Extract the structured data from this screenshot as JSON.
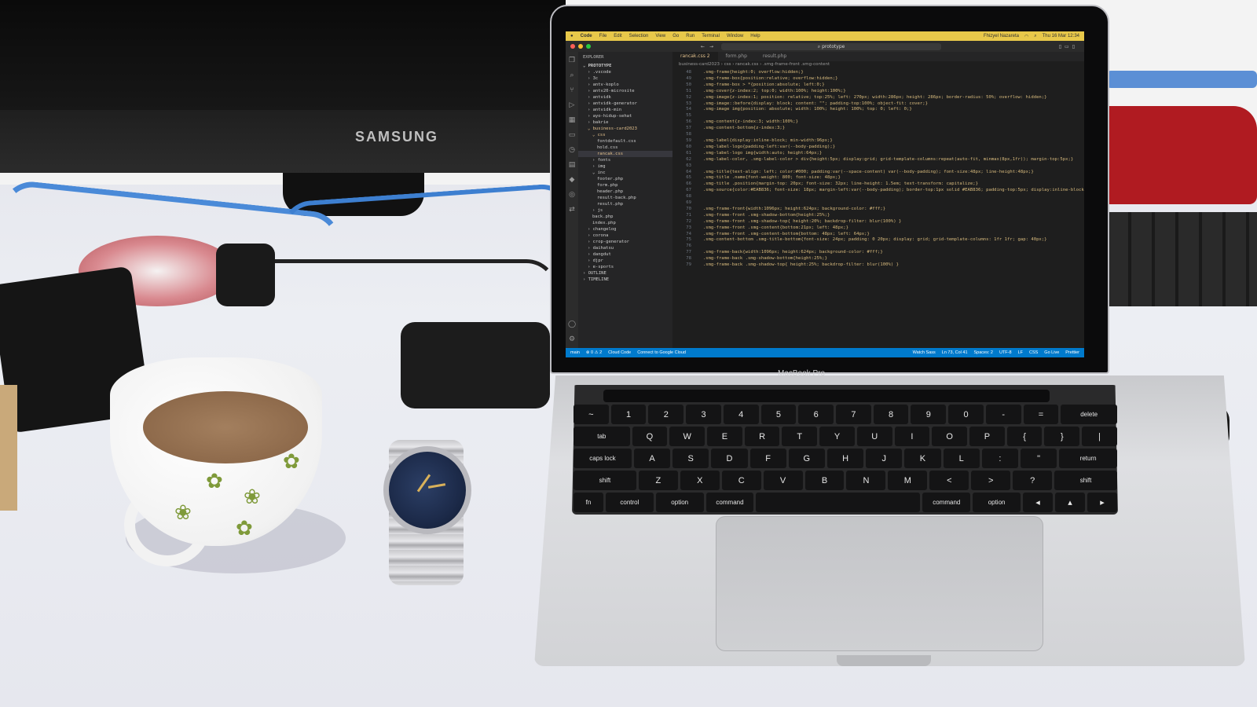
{
  "scene": {
    "monitor_brand": "SAMSUNG",
    "laptop_label": "MacBook Pro"
  },
  "vscode": {
    "menubar": {
      "items": [
        "Code",
        "File",
        "Edit",
        "Selection",
        "View",
        "Go",
        "Run",
        "Terminal",
        "Window",
        "Help"
      ],
      "user": "Fhizyel Nazareta",
      "datetime": "Thu 16 Mar 12:34"
    },
    "command_center": "prototype",
    "explorer": {
      "header": "EXPLORER",
      "project": "PROTOTYPE",
      "items": [
        {
          "label": "› .vscode",
          "depth": 1
        },
        {
          "label": "› 3c",
          "depth": 1
        },
        {
          "label": "› antv-koplo",
          "depth": 1
        },
        {
          "label": "› antv20-microsite",
          "depth": 1
        },
        {
          "label": "› antvidk",
          "depth": 1
        },
        {
          "label": "› antvidk-generator",
          "depth": 1
        },
        {
          "label": "› antvidk-min",
          "depth": 1
        },
        {
          "label": "› ayo-hidup-sehat",
          "depth": 1
        },
        {
          "label": "› bakrie",
          "depth": 1
        },
        {
          "label": "⌄ business-card2023",
          "depth": 1,
          "mod": true
        },
        {
          "label": "⌄ css",
          "depth": 2,
          "mod": true
        },
        {
          "label": "fontdefault.css",
          "depth": 3
        },
        {
          "label": "hold.css",
          "depth": 3
        },
        {
          "label": "rancak.css",
          "depth": 3,
          "active": true,
          "mod": true
        },
        {
          "label": "› fonts",
          "depth": 2
        },
        {
          "label": "› img",
          "depth": 2
        },
        {
          "label": "⌄ inc",
          "depth": 2
        },
        {
          "label": "footer.php",
          "depth": 3
        },
        {
          "label": "form.php",
          "depth": 3
        },
        {
          "label": "header.php",
          "depth": 3
        },
        {
          "label": "result-back.php",
          "depth": 3
        },
        {
          "label": "result.php",
          "depth": 3
        },
        {
          "label": "› js",
          "depth": 2
        },
        {
          "label": "back.php",
          "depth": 2
        },
        {
          "label": "index.php",
          "depth": 2
        },
        {
          "label": "› changelog",
          "depth": 1
        },
        {
          "label": "› corona",
          "depth": 1
        },
        {
          "label": "› crop-generator",
          "depth": 1
        },
        {
          "label": "› daihatsu",
          "depth": 1
        },
        {
          "label": "› dangdut",
          "depth": 1
        },
        {
          "label": "› djpr",
          "depth": 1
        },
        {
          "label": "› e-sports",
          "depth": 1
        },
        {
          "label": "› OUTLINE",
          "depth": 0
        },
        {
          "label": "› TIMELINE",
          "depth": 0
        }
      ]
    },
    "tabs": [
      {
        "label": "rancak.css 2",
        "active": true
      },
      {
        "label": "form.php",
        "active": false
      },
      {
        "label": "result.php",
        "active": false
      }
    ],
    "breadcrumb": "business-card2023 › css › rancak.css › .smg-frame-front .smg-content",
    "code_lines": [
      {
        "n": "48",
        "t": "  .smg-frame{height:0; overflow:hidden;}"
      },
      {
        "n": "49",
        "t": "  .smg-frame-box{position:relative; overflow:hidden;}"
      },
      {
        "n": "50",
        "t": "  .smg-frame-box > *{position:absolute; left:0;}"
      },
      {
        "n": "51",
        "t": "  .smg-cover{z-index:2; top:0; width:100%; height:100%;}"
      },
      {
        "n": "52",
        "t": "  .smg-image{z-index:1; position: relative; top:25%; left: 270px; width:286px; height: 286px; border-radius: 50%; overflow: hidden;}"
      },
      {
        "n": "53",
        "t": "  .smg-image::before{display: block; content: \"\"; padding-top:100%; object-fit: cover;}"
      },
      {
        "n": "54",
        "t": "  .smg-image img{position: absolute; width: 100%; height: 100%; top: 0; left: 0;}"
      },
      {
        "n": "55",
        "t": ""
      },
      {
        "n": "56",
        "t": "  .smg-content{z-index:3; width:100%;}"
      },
      {
        "n": "57",
        "t": "  .smg-content-bottom{z-index:3;}"
      },
      {
        "n": "58",
        "t": ""
      },
      {
        "n": "59",
        "t": "  .smg-label{display:inline-block; min-width:96px;}"
      },
      {
        "n": "60",
        "t": "  .smg-label-logo{padding-left:var(--body-padding);}"
      },
      {
        "n": "61",
        "t": "  .smg-label-logo img{width:auto; height:64px;}"
      },
      {
        "n": "62",
        "t": "  .smg-label-color, .smg-label-color > div{height:5px; display:grid; grid-template-columns:repeat(auto-fit, minmax(8px,1fr)); margin-top:5px;}"
      },
      {
        "n": "63",
        "t": ""
      },
      {
        "n": "64",
        "t": "  .smg-title{text-align: left; color:#000; padding:var(--space-content) var(--body-padding); font-size:48px; line-height:48px;}"
      },
      {
        "n": "65",
        "t": "  .smg-title .name{font-weight: 800; font-size: 48px;}"
      },
      {
        "n": "66",
        "t": "  .smg-title .position{margin-top: 20px; font-size: 32px; line-height: 1.5em; text-transform: capitalize;}"
      },
      {
        "n": "67",
        "t": "  .smg-source{color:#EAB836; font-size: 18px; margin-left:var(--body-padding); border-top:1px solid #EAB836; padding-top:5px; display:inline-block;}"
      },
      {
        "n": "68",
        "t": ""
      },
      {
        "n": "69",
        "t": ""
      },
      {
        "n": "70",
        "t": "  .smg-frame-front{width:1096px; height:624px; background-color: #fff;}"
      },
      {
        "n": "71",
        "t": "  .smg-frame-front .smg-shadow-bottom{height:25%;}"
      },
      {
        "n": "72",
        "t": "  .smg-frame-front .smg-shadow-top{ height:20%; backdrop-filter: blur(100%) }"
      },
      {
        "n": "73",
        "t": "  .smg-frame-front .smg-content{bottom:21px; left: 48px;}"
      },
      {
        "n": "74",
        "t": "  .smg-frame-front .smg-content-bottom{bottom: 48px; left: 64px;}"
      },
      {
        "n": "75",
        "t": "  .smg-content-bottom .smg-title-bottom{font-size: 24px; padding: 0 20px; display: grid; grid-template-columns: 1fr 1fr; gap: 40px;}"
      },
      {
        "n": "76",
        "t": ""
      },
      {
        "n": "77",
        "t": "  .smg-frame-back{width:1096px; height:624px; background-color: #fff;}"
      },
      {
        "n": "78",
        "t": "  .smg-frame-back .smg-shadow-bottom{height:25%;}"
      },
      {
        "n": "79",
        "t": "  .smg-frame-back .smg-shadow-top{ height:25%; backdrop-filter: blur(100%) }"
      }
    ],
    "statusbar": {
      "left": [
        "main",
        "⊗ 0 ⚠ 2",
        "Cloud Code",
        "Connect to Google Cloud"
      ],
      "right": [
        "Watch Sass",
        "Ln 73, Col 41",
        "Spaces: 2",
        "UTF-8",
        "LF",
        "CSS",
        "Go Live",
        "Prettier"
      ]
    }
  },
  "keyboard": {
    "rows": [
      [
        "~",
        "1",
        "2",
        "3",
        "4",
        "5",
        "6",
        "7",
        "8",
        "9",
        "0",
        "-",
        "=",
        "delete"
      ],
      [
        "tab",
        "Q",
        "W",
        "E",
        "R",
        "T",
        "Y",
        "U",
        "I",
        "O",
        "P",
        "{",
        "}",
        "|"
      ],
      [
        "caps lock",
        "A",
        "S",
        "D",
        "F",
        "G",
        "H",
        "J",
        "K",
        "L",
        ":",
        "\"",
        "return"
      ],
      [
        "shift",
        "Z",
        "X",
        "C",
        "V",
        "B",
        "N",
        "M",
        "<",
        ">",
        "?",
        "shift"
      ],
      [
        "fn",
        "control",
        "option",
        "command",
        "",
        "command",
        "option",
        "◂",
        "▴",
        "▸"
      ]
    ]
  },
  "colors": {
    "accent_statusbar": "#007acc",
    "menubar": "#e8c84a"
  }
}
